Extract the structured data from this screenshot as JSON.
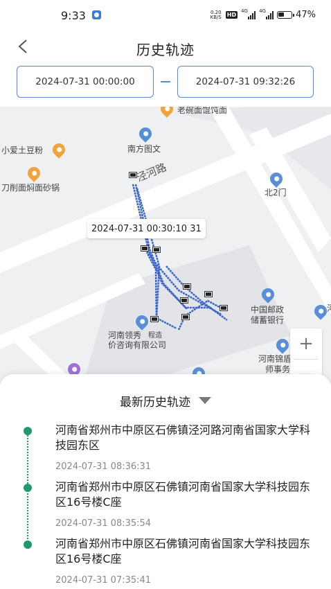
{
  "status_bar": {
    "time": "9:33",
    "net_speed_top": "0.20",
    "net_speed_bottom": "KB/S",
    "hd": "HD",
    "sig1": "4G",
    "sig2": "4G",
    "battery": "47%"
  },
  "header": {
    "title": "历史轨迹",
    "back_icon": "chevron-left-icon"
  },
  "date_range": {
    "start": "2024-07-31 00:00:00",
    "separator": "—",
    "end": "2024-07-31 09:32:26"
  },
  "map": {
    "time_bubble": "2024-07-31 00:30:10 31",
    "road_label": "泾河路",
    "pois": [
      "老碗面馄饨面",
      "南方图文",
      "小爱土豆粉",
      "刀削面焖面砂锅",
      "北2门",
      "中国邮政",
      "储蓄银行",
      "河南领秀",
      "程造",
      "价咨询有限公司",
      "河南锦盾律",
      "师事务所",
      "河"
    ],
    "zoom_in": "+",
    "zoom_out": "−",
    "colors": {
      "track": "#3a66c8",
      "road": "#ffffff",
      "block": "#e4e6ea"
    }
  },
  "history": {
    "title": "最新历史轨迹",
    "dropdown_icon": "triangle-down-icon",
    "accent": "#1f9b6b",
    "items": [
      {
        "address": "河南省郑州市中原区石佛镇泾河路河南省国家大学科技园东区",
        "time": "2024-07-31 08:36:31"
      },
      {
        "address": "河南省郑州市中原区石佛镇河南省国家大学科技园东区16号楼C座",
        "time": "2024-07-31 08:35:54"
      },
      {
        "address": "河南省郑州市中原区石佛镇河南省国家大学科技园东区16号楼C座",
        "time": "2024-07-31 07:35:41"
      }
    ]
  }
}
